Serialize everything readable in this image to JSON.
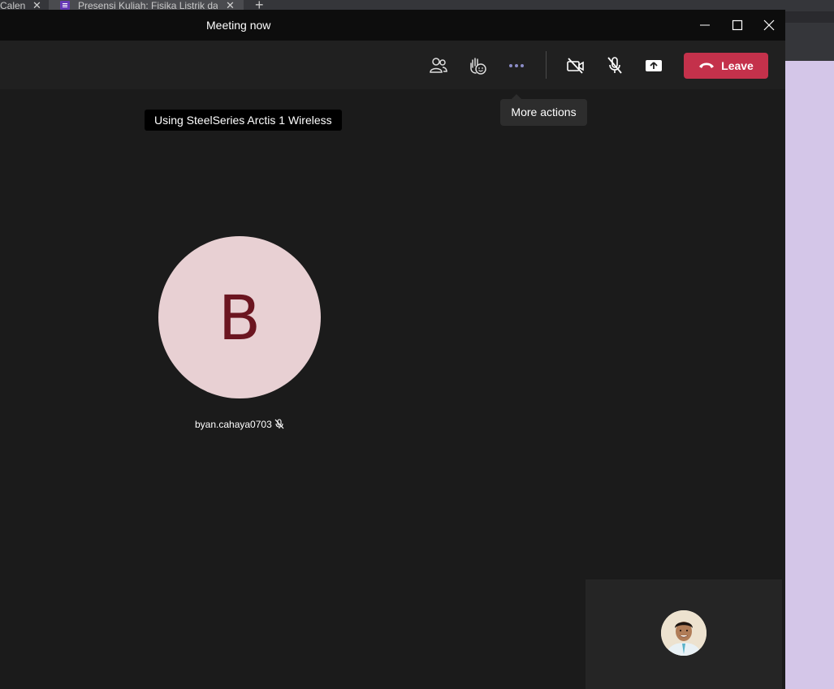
{
  "browser": {
    "tabs": [
      {
        "label": "Calen",
        "close": "✕"
      },
      {
        "label": "Presensi Kuliah: Fisika Listrik dan",
        "close": "✕"
      }
    ],
    "new_tab": "+"
  },
  "window": {
    "title": "Meeting now"
  },
  "toolbar": {
    "leave_label": "Leave"
  },
  "tooltips": {
    "device": "Using SteelSeries Arctis 1 Wireless",
    "more_actions": "More actions"
  },
  "participant": {
    "initial": "B",
    "name": "byan.cahaya0703"
  },
  "colors": {
    "leave_button": "#c4314b",
    "avatar_bg": "#e8d0d3",
    "avatar_initial": "#6b1520",
    "more_icon": "#8b8cc7"
  },
  "icons": {
    "people": "people-icon",
    "react": "raise-hand-react-icon",
    "more": "more-dots-icon",
    "camera": "camera-off-icon",
    "mic": "mic-off-icon",
    "share": "share-screen-icon",
    "hangup": "phone-hangup-icon"
  }
}
